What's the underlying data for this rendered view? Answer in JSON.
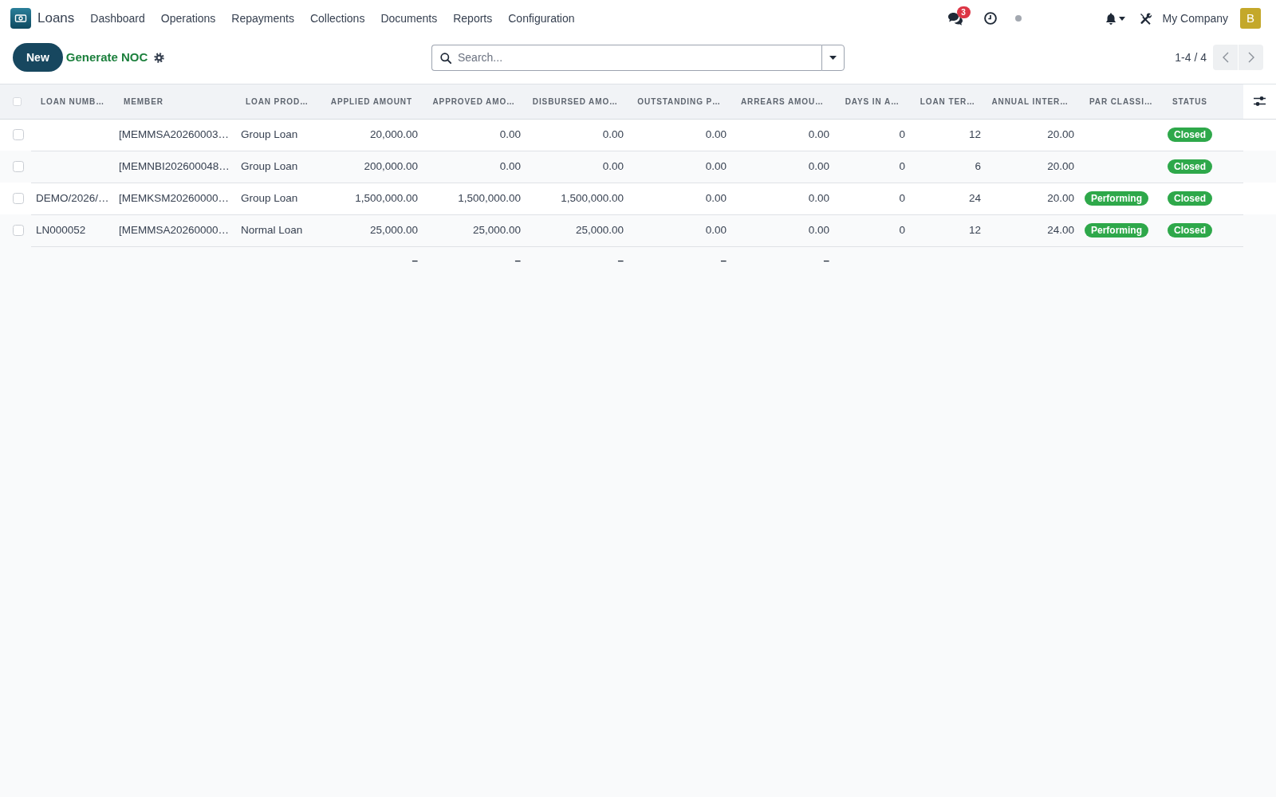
{
  "navbar": {
    "app_name": "Loans",
    "menu": [
      "Dashboard",
      "Operations",
      "Repayments",
      "Collections",
      "Documents",
      "Reports",
      "Configuration"
    ],
    "messages_badge": "3",
    "company": "My Company",
    "avatar_initial": "B"
  },
  "control_panel": {
    "buttons": [
      {
        "label": "New",
        "kind": "primary"
      },
      {
        "label": "Generate NOC",
        "kind": "link"
      }
    ],
    "search": {
      "placeholder": "Search..."
    },
    "pager": "1-4 / 4"
  },
  "table": {
    "select_all": {
      "checked": false
    },
    "columns": [
      {
        "label": "LOAN NUMB…",
        "kind": "text"
      },
      {
        "label": "MEMBER",
        "kind": "text"
      },
      {
        "label": "LOAN PROD…",
        "kind": "text"
      },
      {
        "label": "APPLIED AMOUNT",
        "kind": "number",
        "total": "–"
      },
      {
        "label": "APPROVED AMO…",
        "kind": "number",
        "total": "–"
      },
      {
        "label": "DISBURSED AMO…",
        "kind": "number",
        "total": "–"
      },
      {
        "label": "OUTSTANDING P…",
        "kind": "number",
        "total": "–"
      },
      {
        "label": "ARREARS AMOU…",
        "kind": "number",
        "total": "–"
      },
      {
        "label": "DAYS IN A…",
        "kind": "number"
      },
      {
        "label": "LOAN TER…",
        "kind": "number"
      },
      {
        "label": "ANNUAL INTER…",
        "kind": "number"
      },
      {
        "label": "PAR CLASSI…",
        "kind": "badge"
      },
      {
        "label": "STATUS",
        "kind": "badge"
      }
    ],
    "rows": [
      {
        "selected": false,
        "cells": [
          null,
          "[MEMMSA20260003…",
          "Group Loan",
          "20,000.00",
          "0.00",
          "0.00",
          "0.00",
          "0.00",
          "0",
          "12",
          "20.00",
          null,
          "Closed"
        ]
      },
      {
        "selected": false,
        "cells": [
          null,
          "[MEMNBI202600048…",
          "Group Loan",
          "200,000.00",
          "0.00",
          "0.00",
          "0.00",
          "0.00",
          "0",
          "6",
          "20.00",
          null,
          "Closed"
        ]
      },
      {
        "selected": false,
        "cells": [
          "DEMO/2026/…",
          "[MEMKSM20260000…",
          "Group Loan",
          "1,500,000.00",
          "1,500,000.00",
          "1,500,000.00",
          "0.00",
          "0.00",
          "0",
          "24",
          "20.00",
          "Performing",
          "Closed"
        ]
      },
      {
        "selected": false,
        "cells": [
          "LN000052",
          "[MEMMSA20260000…",
          "Normal Loan",
          "25,000.00",
          "25,000.00",
          "25,000.00",
          "0.00",
          "0.00",
          "0",
          "12",
          "24.00",
          "Performing",
          "Closed"
        ]
      }
    ]
  }
}
